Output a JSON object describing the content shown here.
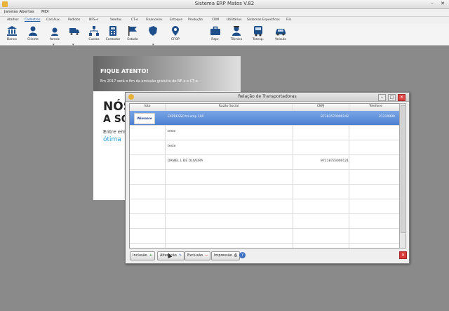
{
  "window": {
    "title": "Sistema ERP Matos V.82"
  },
  "menubar": {
    "items": [
      "Janelas Abertas",
      "MDI"
    ]
  },
  "tabs": [
    "Atalhos",
    "Cadastros",
    "Cad.Aux.",
    "Pedidos",
    "NFS-e",
    "Vendas",
    "CT-e",
    "Financeiro",
    "Estoque",
    "Produção",
    "CRM",
    "Utilitários",
    "Sistemas Especificos",
    "Fiis"
  ],
  "active_tab": "Cadastros",
  "toolbar": [
    {
      "label": "Banco",
      "icon": "bank-icon"
    },
    {
      "label": "Cliente",
      "icon": "client-icon"
    },
    {
      "label": "fornec",
      "icon": "supplier-icon"
    },
    {
      "label": "",
      "icon": "truck-icon"
    },
    {
      "label": "Custos",
      "icon": "cost-tree-icon"
    },
    {
      "label": "Contador",
      "icon": "calculator-icon"
    },
    {
      "label": "Estado",
      "icon": "flag-icon"
    },
    {
      "label": "",
      "icon": "map-icon"
    },
    {
      "label": "CFOP",
      "icon": "location-pin-icon"
    },
    {
      "label": "Repr.",
      "icon": "briefcase-icon"
    },
    {
      "label": "Técnico",
      "icon": "technician-icon"
    },
    {
      "label": "Transp.",
      "icon": "bus-icon"
    },
    {
      "label": "Veiculo",
      "icon": "car-icon"
    }
  ],
  "banner": {
    "line1": "FIQUE ATENTO!",
    "line2": "Em 2017 será o fim da emissão gratuita de NF-e e CT-e.",
    "line3": "NÓS",
    "line4": "A SO",
    "line5": "Entre em",
    "line6": "ótima"
  },
  "dialog": {
    "title": "Relação de Transportadoras",
    "columns": [
      "foto",
      "Razão Social",
      "CNPJ",
      "Telefone"
    ],
    "rows": [
      {
        "logo": "Winsoare",
        "razao": "EXPRESSO td emp 100",
        "cnpj": "87183570000142",
        "telefone": "21210999",
        "selected": true
      },
      {
        "logo": "",
        "razao": "teste",
        "cnpj": "",
        "telefone": "",
        "selected": false
      },
      {
        "logo": "",
        "razao": "teste",
        "cnpj": "",
        "telefone": "",
        "selected": false
      },
      {
        "logo": "",
        "razao": "DANIEL L DE OLIVEIRA",
        "cnpj": "97118723000121",
        "telefone": "",
        "selected": false
      },
      {
        "logo": "",
        "razao": "",
        "cnpj": "",
        "telefone": "",
        "selected": false
      },
      {
        "logo": "",
        "razao": "",
        "cnpj": "",
        "telefone": "",
        "selected": false
      },
      {
        "logo": "",
        "razao": "",
        "cnpj": "",
        "telefone": "",
        "selected": false
      },
      {
        "logo": "",
        "razao": "",
        "cnpj": "",
        "telefone": "",
        "selected": false
      },
      {
        "logo": "",
        "razao": "",
        "cnpj": "",
        "telefone": "",
        "selected": false
      }
    ],
    "buttons": {
      "inclusao": "Inclusão",
      "alteracao": "Alteração",
      "exclusao": "Exclusão",
      "impressao": "Impressão"
    }
  },
  "colors": {
    "selection": "#4c7fd0",
    "accent": "#1e5aa8",
    "toolbar_icon": "#1f4f8a"
  }
}
